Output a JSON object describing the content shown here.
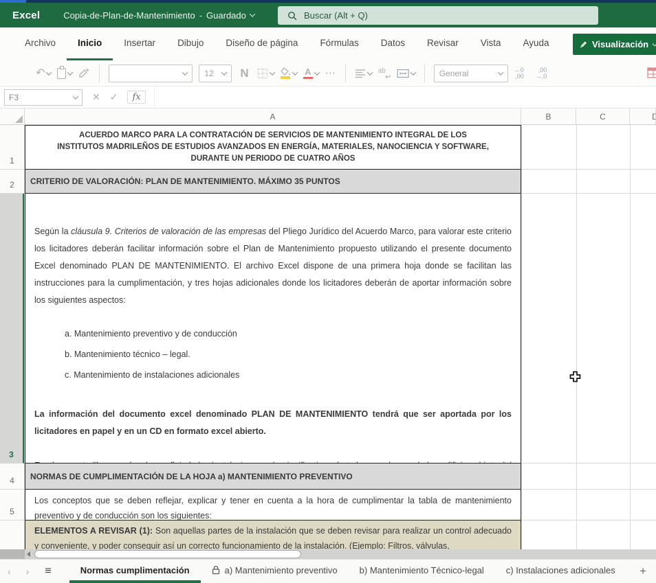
{
  "colors": {
    "accent_green": "#217346",
    "titlebar_green": "#1e6b41",
    "cell_gray": "#d9d9d9",
    "cell_tan": "#ddd9c3"
  },
  "chrome": {
    "app_name": "Excel",
    "doc_title": "Copia-de-Plan-de-Mantenimiento",
    "separator": "-",
    "save_status": "Guardado",
    "search_placeholder": "Buscar (Alt + Q)"
  },
  "ribbon": {
    "tabs": [
      {
        "label": "Archivo"
      },
      {
        "label": "Inicio"
      },
      {
        "label": "Insertar"
      },
      {
        "label": "Dibujo"
      },
      {
        "label": "Diseño de página"
      },
      {
        "label": "Fórmulas"
      },
      {
        "label": "Datos"
      },
      {
        "label": "Revisar"
      },
      {
        "label": "Vista"
      },
      {
        "label": "Ayuda"
      }
    ],
    "active_tab": "Inicio",
    "view_button_label": "Visualización",
    "toolbar": {
      "undo_glyph": "↶",
      "font_name_value": "",
      "font_size_value": "12",
      "bold_label": "N",
      "more_glyph": "⋯",
      "wrap_label": "ab",
      "wrap_arrow": "↩",
      "merge_glyph": "↔",
      "number_format_value": "General",
      "decimal_decrease": {
        "line1": "←0",
        "line2": ",00"
      },
      "decimal_increase": {
        "line1": ",00",
        "line2": "→,0"
      }
    }
  },
  "formula_bar": {
    "name_box_value": "F3",
    "cancel_glyph": "✕",
    "enter_glyph": "✓",
    "fx_label": "fx",
    "formula_value": ""
  },
  "grid": {
    "columns": [
      "A",
      "B",
      "C",
      "D"
    ],
    "rows": [
      "1",
      "2",
      "3",
      "4",
      "5"
    ],
    "cells": {
      "a1": "ACUERDO MARCO PARA LA CONTRATACIÓN DE SERVICIOS DE MANTENIMIENTO INTEGRAL DE LOS INSTITUTOS MADRILEÑOS DE ESTUDIOS AVANZADOS EN ENERGÍA, MATERIALES, NANOCIENCIA Y SOFTWARE, DURANTE UN PERIODO DE CUATRO AÑOS",
      "a2": "CRITERIO DE VALORACIÓN: PLAN DE MANTENIMIENTO. MÁXIMO 35 PUNTOS",
      "a3": {
        "p1_prefix": "Según la ",
        "p1_italic": "cláusula 9. Criterios de valoración de las empresas",
        "p1_rest": " del Pliego Jurídico del Acuerdo Marco, para valorar este criterio los licitadores deberán facilitar información sobre el Plan de Mantenimiento propuesto utilizando el presente documento Excel denominado PLAN DE MANTENIMIENTO. El archivo Excel dispone de una primera hoja donde se facilitan las instrucciones para la cumplimentación, y tres hojas adicionales donde los licitadores deberán de aportar información sobre los siguientes aspectos:",
        "list": [
          "a. Mantenimiento preventivo y de conducción",
          "b. Mantenimiento técnico – legal.",
          "c. Mantenimiento de instalaciones adicionales"
        ],
        "p2_bold": "La información del documento excel denominado PLAN DE MANTENIMIENTO tendrá que ser aportada por los licitadores en papel y en un CD en formato excel abierto.",
        "p3": "En el presente libro excel se han reflejado las instalaciones más significativas de todos y cada uno de los edificios objeto del acuerdo marco.  Esto no exime a la empresa adjudicataria de realizar el mantenimiento  de las instalaciones que pudieran existir en los diferentes edificios y que no aparezcan reflejadas en las tablas facilitadas."
      },
      "a4": "NORMAS DE CUMPLIMENTACIÓN DE LA HOJA a) MANTENIMIENTO PREVENTIVO",
      "a5": "Los conceptos que se deben reflejar, explicar y tener en cuenta a la hora de cumplimentar la tabla de mantenimiento preventivo y de conducción son los siguientes:",
      "a6_bold": "ELEMENTOS  A REVISAR  (1):",
      "a6_rest": "  Son  aquellas partes de la instalación que se deben revisar para realizar un  control adecuado y conveniente, y poder conseguir así un correcto funcionamiento de la instalación. (Ejemplo: Filtros,  válvulas,"
    }
  },
  "sheet_bar": {
    "prev_glyph": "‹",
    "next_glyph": "›",
    "menu_glyph": "≡",
    "add_glyph": "+",
    "items": [
      {
        "label": "Normas cumplimentación",
        "active": true
      },
      {
        "label": "a) Mantenimiento preventivo",
        "locked": true
      },
      {
        "label": "b) Mantenimiento Técnico-legal"
      },
      {
        "label": "c) Instalaciones adicionales"
      }
    ]
  }
}
